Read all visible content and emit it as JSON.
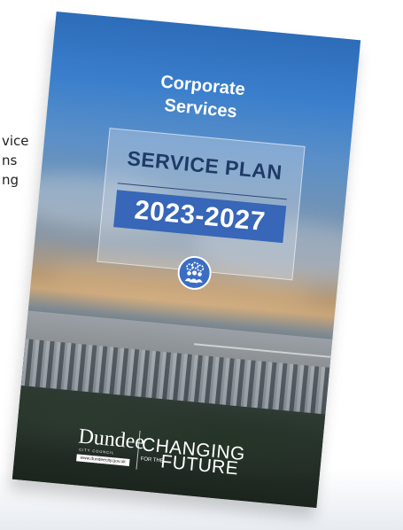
{
  "background_text": [
    "vice",
    "ns",
    "ng"
  ],
  "cover": {
    "heading_line1": "Corporate",
    "heading_line2": "Services",
    "plan_title": "SERVICE PLAN",
    "years": "2023-2027",
    "icon": "people-gears-icon",
    "logo": {
      "dundee": "Dundee",
      "council": "CITY COUNCIL",
      "url": "www.dundeecity.gov.uk",
      "changing": "CHANGING",
      "for_the": "FOR THE",
      "future": "FUTURE"
    }
  },
  "colors": {
    "accent_blue": "#3866b8",
    "panel_text": "#1f3a66",
    "heading_text": "#ffffff"
  }
}
